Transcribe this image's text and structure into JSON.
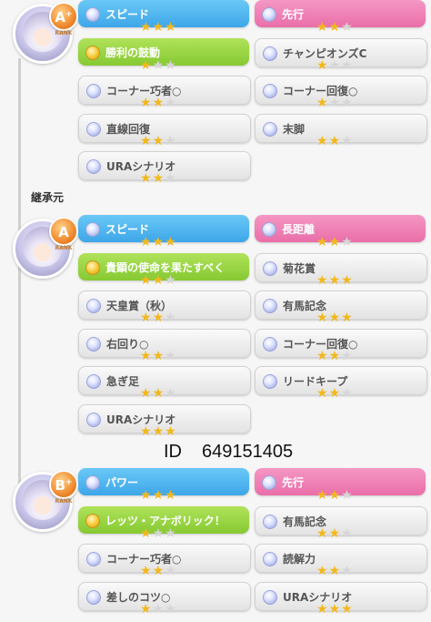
{
  "colors": {
    "blue": "#3ea6e9",
    "pink": "#ea6ea9",
    "green": "#86c932",
    "gray": "#e3e3e3",
    "star": "#f2b81c"
  },
  "inherit_label": "継承元",
  "id": {
    "prefix": "ID",
    "value": "649151405"
  },
  "sections": [
    {
      "rank": "A",
      "rank_suffix": "+",
      "rank_text": "RANK",
      "rows": [
        [
          {
            "label": "スピード",
            "color": "blue",
            "stars": 3,
            "dot": "normal"
          },
          {
            "label": "先行",
            "color": "pink",
            "stars": 2,
            "dot": "normal"
          }
        ],
        [
          {
            "label": "勝利の鼓動",
            "color": "green",
            "stars": 1,
            "dot": "gold"
          },
          {
            "label": "チャンピオンズC",
            "color": "gray",
            "stars": 1,
            "dot": "normal"
          }
        ],
        [
          {
            "label": "コーナー巧者○",
            "color": "gray",
            "stars": 2,
            "dot": "normal"
          },
          {
            "label": "コーナー回復○",
            "color": "gray",
            "stars": 1,
            "dot": "normal"
          }
        ],
        [
          {
            "label": "直線回復",
            "color": "gray",
            "stars": 2,
            "dot": "normal"
          },
          {
            "label": "末脚",
            "color": "gray",
            "stars": 2,
            "dot": "normal"
          }
        ],
        [
          {
            "label": "URAシナリオ",
            "color": "gray",
            "stars": 2,
            "dot": "normal"
          }
        ]
      ]
    },
    {
      "rank": "A",
      "rank_suffix": "",
      "rank_text": "RANK",
      "rows": [
        [
          {
            "label": "スピード",
            "color": "blue",
            "stars": 3,
            "dot": "normal"
          },
          {
            "label": "長距離",
            "color": "pink",
            "stars": 2,
            "dot": "normal"
          }
        ],
        [
          {
            "label": "貴顕の使命を果たすべく",
            "color": "green",
            "stars": 2,
            "dot": "gold"
          },
          {
            "label": "菊花賞",
            "color": "gray",
            "stars": 3,
            "dot": "normal"
          }
        ],
        [
          {
            "label": "天皇賞（秋）",
            "color": "gray",
            "stars": 2,
            "dot": "normal"
          },
          {
            "label": "有馬記念",
            "color": "gray",
            "stars": 3,
            "dot": "normal"
          }
        ],
        [
          {
            "label": "右回り○",
            "color": "gray",
            "stars": 2,
            "dot": "normal"
          },
          {
            "label": "コーナー回復○",
            "color": "gray",
            "stars": 2,
            "dot": "normal"
          }
        ],
        [
          {
            "label": "急ぎ足",
            "color": "gray",
            "stars": 2,
            "dot": "normal"
          },
          {
            "label": "リードキープ",
            "color": "gray",
            "stars": 2,
            "dot": "normal"
          }
        ],
        [
          {
            "label": "URAシナリオ",
            "color": "gray",
            "stars": 3,
            "dot": "normal"
          }
        ]
      ]
    },
    {
      "rank": "B",
      "rank_suffix": "+",
      "rank_text": "RANK",
      "rows": [
        [
          {
            "label": "パワー",
            "color": "blue",
            "stars": 3,
            "dot": "normal"
          },
          {
            "label": "先行",
            "color": "pink",
            "stars": 2,
            "dot": "normal"
          }
        ],
        [
          {
            "label": "レッツ・アナボリック！",
            "color": "green",
            "stars": 1,
            "dot": "gold"
          },
          {
            "label": "有馬記念",
            "color": "gray",
            "stars": 2,
            "dot": "normal"
          }
        ],
        [
          {
            "label": "コーナー巧者○",
            "color": "gray",
            "stars": 2,
            "dot": "normal"
          },
          {
            "label": "読解力",
            "color": "gray",
            "stars": 2,
            "dot": "normal"
          }
        ],
        [
          {
            "label": "差しのコツ○",
            "color": "gray",
            "stars": 1,
            "dot": "normal"
          },
          {
            "label": "URAシナリオ",
            "color": "gray",
            "stars": 3,
            "dot": "normal"
          }
        ]
      ]
    }
  ]
}
